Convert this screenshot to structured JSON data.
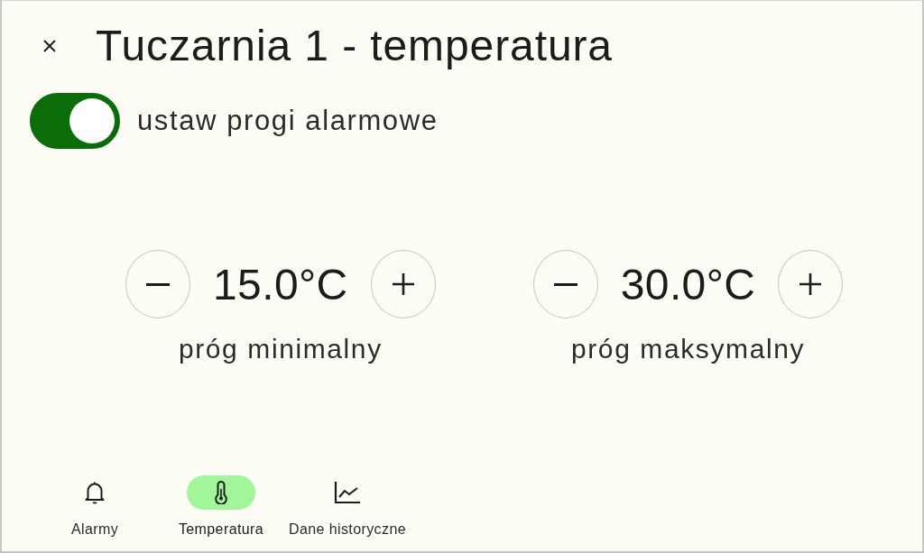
{
  "dialog": {
    "title": "Tuczarnia 1 - temperatura"
  },
  "alarm_toggle": {
    "label": "ustaw progi alarmowe",
    "on": true
  },
  "thresholds": [
    {
      "value": "15.0°C",
      "label": "próg minimalny"
    },
    {
      "value": "30.0°C",
      "label": "próg maksymalny"
    }
  ],
  "nav": [
    {
      "kind": "alarms",
      "label": "Alarmy",
      "selected": false
    },
    {
      "kind": "temperature",
      "label": "Temperatura",
      "selected": true
    },
    {
      "kind": "history",
      "label": "Dane historyczne",
      "selected": false
    }
  ]
}
